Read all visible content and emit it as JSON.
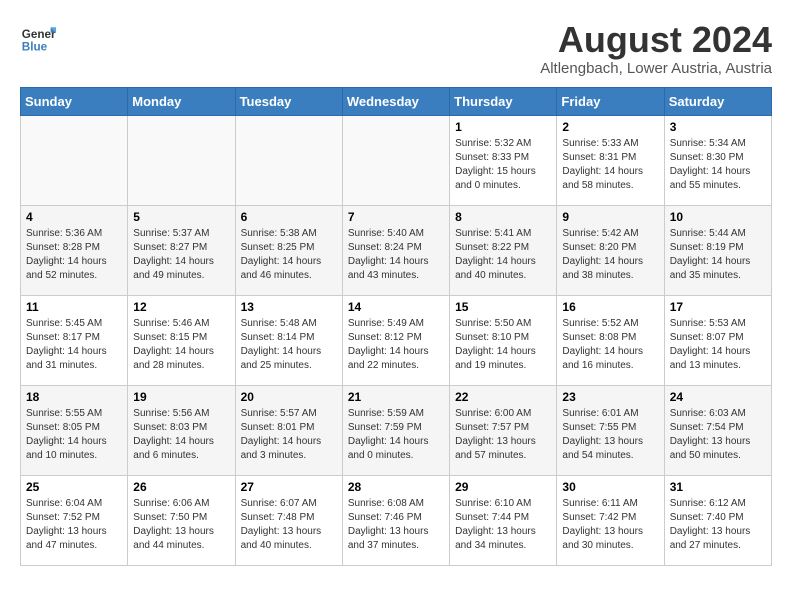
{
  "header": {
    "logo_line1": "General",
    "logo_line2": "Blue",
    "month_year": "August 2024",
    "location": "Altlengbach, Lower Austria, Austria"
  },
  "weekdays": [
    "Sunday",
    "Monday",
    "Tuesday",
    "Wednesday",
    "Thursday",
    "Friday",
    "Saturday"
  ],
  "weeks": [
    [
      {
        "day": "",
        "info": ""
      },
      {
        "day": "",
        "info": ""
      },
      {
        "day": "",
        "info": ""
      },
      {
        "day": "",
        "info": ""
      },
      {
        "day": "1",
        "info": "Sunrise: 5:32 AM\nSunset: 8:33 PM\nDaylight: 15 hours\nand 0 minutes."
      },
      {
        "day": "2",
        "info": "Sunrise: 5:33 AM\nSunset: 8:31 PM\nDaylight: 14 hours\nand 58 minutes."
      },
      {
        "day": "3",
        "info": "Sunrise: 5:34 AM\nSunset: 8:30 PM\nDaylight: 14 hours\nand 55 minutes."
      }
    ],
    [
      {
        "day": "4",
        "info": "Sunrise: 5:36 AM\nSunset: 8:28 PM\nDaylight: 14 hours\nand 52 minutes."
      },
      {
        "day": "5",
        "info": "Sunrise: 5:37 AM\nSunset: 8:27 PM\nDaylight: 14 hours\nand 49 minutes."
      },
      {
        "day": "6",
        "info": "Sunrise: 5:38 AM\nSunset: 8:25 PM\nDaylight: 14 hours\nand 46 minutes."
      },
      {
        "day": "7",
        "info": "Sunrise: 5:40 AM\nSunset: 8:24 PM\nDaylight: 14 hours\nand 43 minutes."
      },
      {
        "day": "8",
        "info": "Sunrise: 5:41 AM\nSunset: 8:22 PM\nDaylight: 14 hours\nand 40 minutes."
      },
      {
        "day": "9",
        "info": "Sunrise: 5:42 AM\nSunset: 8:20 PM\nDaylight: 14 hours\nand 38 minutes."
      },
      {
        "day": "10",
        "info": "Sunrise: 5:44 AM\nSunset: 8:19 PM\nDaylight: 14 hours\nand 35 minutes."
      }
    ],
    [
      {
        "day": "11",
        "info": "Sunrise: 5:45 AM\nSunset: 8:17 PM\nDaylight: 14 hours\nand 31 minutes."
      },
      {
        "day": "12",
        "info": "Sunrise: 5:46 AM\nSunset: 8:15 PM\nDaylight: 14 hours\nand 28 minutes."
      },
      {
        "day": "13",
        "info": "Sunrise: 5:48 AM\nSunset: 8:14 PM\nDaylight: 14 hours\nand 25 minutes."
      },
      {
        "day": "14",
        "info": "Sunrise: 5:49 AM\nSunset: 8:12 PM\nDaylight: 14 hours\nand 22 minutes."
      },
      {
        "day": "15",
        "info": "Sunrise: 5:50 AM\nSunset: 8:10 PM\nDaylight: 14 hours\nand 19 minutes."
      },
      {
        "day": "16",
        "info": "Sunrise: 5:52 AM\nSunset: 8:08 PM\nDaylight: 14 hours\nand 16 minutes."
      },
      {
        "day": "17",
        "info": "Sunrise: 5:53 AM\nSunset: 8:07 PM\nDaylight: 14 hours\nand 13 minutes."
      }
    ],
    [
      {
        "day": "18",
        "info": "Sunrise: 5:55 AM\nSunset: 8:05 PM\nDaylight: 14 hours\nand 10 minutes."
      },
      {
        "day": "19",
        "info": "Sunrise: 5:56 AM\nSunset: 8:03 PM\nDaylight: 14 hours\nand 6 minutes."
      },
      {
        "day": "20",
        "info": "Sunrise: 5:57 AM\nSunset: 8:01 PM\nDaylight: 14 hours\nand 3 minutes."
      },
      {
        "day": "21",
        "info": "Sunrise: 5:59 AM\nSunset: 7:59 PM\nDaylight: 14 hours\nand 0 minutes."
      },
      {
        "day": "22",
        "info": "Sunrise: 6:00 AM\nSunset: 7:57 PM\nDaylight: 13 hours\nand 57 minutes."
      },
      {
        "day": "23",
        "info": "Sunrise: 6:01 AM\nSunset: 7:55 PM\nDaylight: 13 hours\nand 54 minutes."
      },
      {
        "day": "24",
        "info": "Sunrise: 6:03 AM\nSunset: 7:54 PM\nDaylight: 13 hours\nand 50 minutes."
      }
    ],
    [
      {
        "day": "25",
        "info": "Sunrise: 6:04 AM\nSunset: 7:52 PM\nDaylight: 13 hours\nand 47 minutes."
      },
      {
        "day": "26",
        "info": "Sunrise: 6:06 AM\nSunset: 7:50 PM\nDaylight: 13 hours\nand 44 minutes."
      },
      {
        "day": "27",
        "info": "Sunrise: 6:07 AM\nSunset: 7:48 PM\nDaylight: 13 hours\nand 40 minutes."
      },
      {
        "day": "28",
        "info": "Sunrise: 6:08 AM\nSunset: 7:46 PM\nDaylight: 13 hours\nand 37 minutes."
      },
      {
        "day": "29",
        "info": "Sunrise: 6:10 AM\nSunset: 7:44 PM\nDaylight: 13 hours\nand 34 minutes."
      },
      {
        "day": "30",
        "info": "Sunrise: 6:11 AM\nSunset: 7:42 PM\nDaylight: 13 hours\nand 30 minutes."
      },
      {
        "day": "31",
        "info": "Sunrise: 6:12 AM\nSunset: 7:40 PM\nDaylight: 13 hours\nand 27 minutes."
      }
    ]
  ]
}
